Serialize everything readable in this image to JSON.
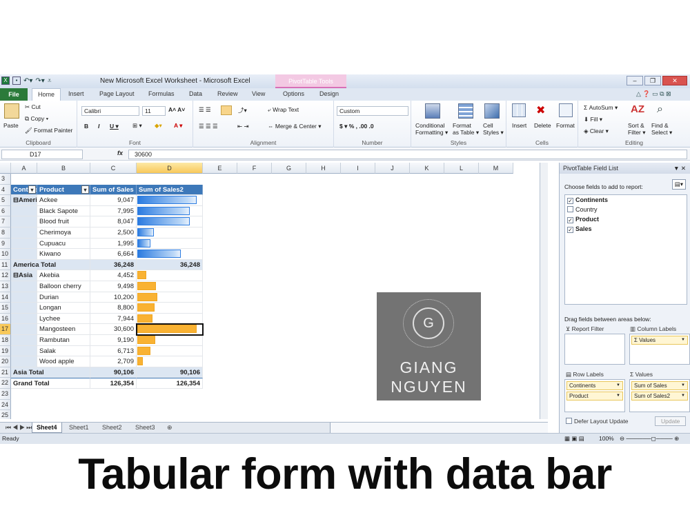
{
  "window": {
    "title": "New Microsoft Excel Worksheet - Microsoft Excel",
    "context_tab": "PivotTable Tools"
  },
  "tabs": [
    "File",
    "Home",
    "Insert",
    "Page Layout",
    "Formulas",
    "Data",
    "Review",
    "View",
    "Options",
    "Design"
  ],
  "ribbon": {
    "clipboard": {
      "label": "Clipboard",
      "paste": "Paste",
      "cut": "Cut",
      "copy": "Copy ▾",
      "painter": "Format Painter"
    },
    "font": {
      "label": "Font",
      "name": "Calibri",
      "size": "11"
    },
    "alignment": {
      "label": "Alignment",
      "wrap": "Wrap Text",
      "merge": "Merge & Center ▾"
    },
    "number": {
      "label": "Number",
      "format": "Custom",
      "symbols": "$ ▾  %  ,  .00  .0"
    },
    "styles": {
      "label": "Styles",
      "cond1": "Conditional",
      "cond2": "Formatting ▾",
      "fmt1": "Format",
      "fmt2": "as Table ▾",
      "cell1": "Cell",
      "cell2": "Styles ▾"
    },
    "cells": {
      "label": "Cells",
      "insert": "Insert",
      "delete": "Delete",
      "format": "Format"
    },
    "editing": {
      "label": "Editing",
      "autosum": "AutoSum ▾",
      "fill": "Fill ▾",
      "clear": "Clear ▾",
      "sort1": "Sort &",
      "sort2": "Filter ▾",
      "find1": "Find &",
      "find2": "Select ▾"
    }
  },
  "formula_bar": {
    "cell": "D17",
    "fx": "fx",
    "value": "30600"
  },
  "columns": [
    "A",
    "B",
    "C",
    "D",
    "E",
    "F",
    "G",
    "H",
    "I",
    "J",
    "K",
    "L",
    "M"
  ],
  "selected_col": "D",
  "rows": [
    "3",
    "4",
    "5",
    "6",
    "7",
    "8",
    "9",
    "10",
    "11",
    "12",
    "13",
    "14",
    "15",
    "16",
    "17",
    "18",
    "19",
    "20",
    "21",
    "22",
    "23",
    "24",
    "25"
  ],
  "selected_row": "17",
  "pivot": {
    "headers": [
      "Continents",
      "Product",
      "Sum of Sales",
      "Sum of Sales2"
    ],
    "groups": [
      {
        "name": "America",
        "color": "blue",
        "items": [
          {
            "product": "Ackee",
            "sales": "9,047",
            "v": 9047
          },
          {
            "product": "Black Sapote",
            "sales": "7,995",
            "v": 7995
          },
          {
            "product": "Blood fruit",
            "sales": "8,047",
            "v": 8047
          },
          {
            "product": "Cherimoya",
            "sales": "2,500",
            "v": 2500
          },
          {
            "product": "Cupuacu",
            "sales": "1,995",
            "v": 1995
          },
          {
            "product": "Kiwano",
            "sales": "6,664",
            "v": 6664
          }
        ],
        "total_label": "America Total",
        "total": "36,248",
        "total2": "36,248"
      },
      {
        "name": "Asia",
        "color": "orange",
        "items": [
          {
            "product": "Akebia",
            "sales": "4,452",
            "v": 4452
          },
          {
            "product": "Balloon cherry",
            "sales": "9,498",
            "v": 9498
          },
          {
            "product": "Durian",
            "sales": "10,200",
            "v": 10200
          },
          {
            "product": "Longan",
            "sales": "8,800",
            "v": 8800
          },
          {
            "product": "Lychee",
            "sales": "7,944",
            "v": 7944
          },
          {
            "product": "Mangosteen",
            "sales": "30,600",
            "v": 30600
          },
          {
            "product": "Rambutan",
            "sales": "9,190",
            "v": 9190
          },
          {
            "product": "Salak",
            "sales": "6,713",
            "v": 6713
          },
          {
            "product": "Wood apple",
            "sales": "2,709",
            "v": 2709
          }
        ],
        "total_label": "Asia Total",
        "total": "90,106",
        "total2": "90,106"
      }
    ],
    "grand_label": "Grand Total",
    "grand": "126,354",
    "grand2": "126,354"
  },
  "sheet_tabs": [
    "Sheet4",
    "Sheet1",
    "Sheet2",
    "Sheet3"
  ],
  "status": {
    "ready": "Ready",
    "zoom": "100%"
  },
  "field_list": {
    "title": "PivotTable Field List",
    "choose": "Choose fields to add to report:",
    "fields": [
      {
        "name": "Continents",
        "checked": true
      },
      {
        "name": "Country",
        "checked": false
      },
      {
        "name": "Product",
        "checked": true
      },
      {
        "name": "Sales",
        "checked": true
      }
    ],
    "drag": "Drag fields between areas below:",
    "report_filter": "Report Filter",
    "column_labels": "Column Labels",
    "row_labels": "Row Labels",
    "values": "Values",
    "col_items": [
      "Σ Values"
    ],
    "row_items": [
      "Continents",
      "Product"
    ],
    "value_items": [
      "Sum of Sales",
      "Sum of Sales2"
    ],
    "defer": "Defer Layout Update",
    "update": "Update"
  },
  "watermark": {
    "letter": "G",
    "line1": "GIANG",
    "line2": "NGUYEN"
  },
  "caption": "Tabular form with data bar"
}
